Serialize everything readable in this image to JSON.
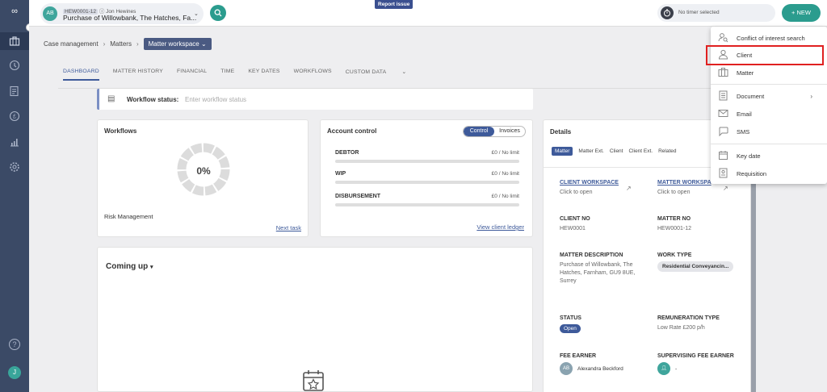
{
  "topbar": {
    "matter_avatar": "AB",
    "matter_ref": "HEW0001-12",
    "matter_ref_icon": "info-icon",
    "matter_client": "Jon Hewines",
    "matter_name": "Purchase of Willowbank, The Hatches, Fa...",
    "report_issue": "Report issue",
    "timer_text": "No timer selected",
    "new_button": "+ NEW"
  },
  "sidebar": {
    "items": [
      "briefcase-icon",
      "clock-icon",
      "document-list-icon",
      "pound-icon",
      "chart-icon",
      "gear-icon"
    ],
    "help": "?",
    "user_initial": "J"
  },
  "breadcrumb": {
    "items": [
      "Case management",
      "Matters"
    ],
    "current": "Matter workspace"
  },
  "tabs": [
    "DASHBOARD",
    "MATTER HISTORY",
    "FINANCIAL",
    "TIME",
    "KEY DATES",
    "WORKFLOWS",
    "CUSTOM DATA"
  ],
  "workflow_status": {
    "label": "Workflow status:",
    "placeholder": "Enter workflow status"
  },
  "workflows_card": {
    "title": "Workflows",
    "progress_pct": "0%",
    "progress_value": 0,
    "name": "Risk Management",
    "next_task": "Next task"
  },
  "account_control": {
    "title": "Account control",
    "toggle": [
      "Control",
      "Invoices"
    ],
    "rows": [
      {
        "label": "DEBTOR",
        "value": "£0 / No limit"
      },
      {
        "label": "WIP",
        "value": "£0 / No limit"
      },
      {
        "label": "DISBURSEMENT",
        "value": "£0 / No limit"
      }
    ],
    "ledger_link": "View client ledger"
  },
  "coming_up": {
    "title": "Coming up"
  },
  "details": {
    "title": "Details",
    "subtabs": [
      "Matter",
      "Matter Ext.",
      "Client",
      "Client Ext.",
      "Related"
    ],
    "client_workspace": "CLIENT WORKSPACE",
    "client_workspace_sub": "Click to open",
    "matter_workspace": "MATTER WORKSPA",
    "matter_workspace_sub": "Click to open",
    "client_no_label": "CLIENT NO",
    "client_no": "HEW0001",
    "matter_no_label": "MATTER NO",
    "matter_no": "HEW0001-12",
    "matter_desc_label": "MATTER DESCRIPTION",
    "matter_desc": "Purchase of Willowbank, The Hatches, Farnham, GU9 8UE, Surrey",
    "work_type_label": "WORK TYPE",
    "work_type": "Residential Conveyancin...",
    "status_label": "STATUS",
    "status": "Open",
    "remuneration_label": "REMUNERATION TYPE",
    "remuneration": "Low Rate £200 p/h",
    "fee_earner_label": "FEE EARNER",
    "fee_earner_avatar": "AB",
    "fee_earner": "Alexandra Beckford",
    "supervising_label": "SUPERVISING FEE EARNER",
    "supervising": "-"
  },
  "new_menu": {
    "items": [
      {
        "label": "Conflict of interest search",
        "icon": "person-search-icon"
      },
      {
        "label": "Client",
        "icon": "person-icon"
      },
      {
        "label": "Matter",
        "icon": "briefcase-icon"
      },
      {
        "label": "Document",
        "icon": "document-icon"
      },
      {
        "label": "Email",
        "icon": "envelope-icon"
      },
      {
        "label": "SMS",
        "icon": "chat-bubble-icon"
      },
      {
        "label": "Key date",
        "icon": "calendar-icon"
      },
      {
        "label": "Requisition",
        "icon": "requisition-icon"
      }
    ]
  },
  "colors": {
    "rail": "#3b4a66",
    "accent": "#3e5a9a",
    "teal": "#2b9c8e",
    "highlight": "#e02020"
  }
}
